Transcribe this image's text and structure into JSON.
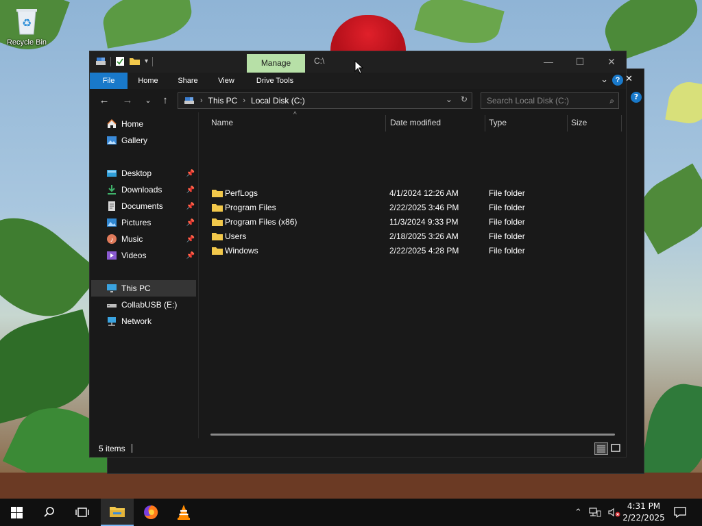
{
  "desktop": {
    "recycle_bin_label": "Recycle Bin"
  },
  "window": {
    "manage_tab": "Manage",
    "title": "C:\\",
    "minimize": "—",
    "maximize": "☐",
    "close": "✕"
  },
  "ribbon": {
    "tabs": [
      "File",
      "Home",
      "Share",
      "View",
      "Drive Tools"
    ]
  },
  "address": {
    "crumbs": [
      "This PC",
      "Local Disk (C:)"
    ],
    "search_placeholder": "Search Local Disk (C:)"
  },
  "nav": {
    "items": [
      "Home",
      "Gallery",
      "Desktop",
      "Downloads",
      "Documents",
      "Pictures",
      "Music",
      "Videos",
      "This PC",
      "CollabUSB (E:)",
      "Network"
    ]
  },
  "columns": [
    "Name",
    "Date modified",
    "Type",
    "Size"
  ],
  "files": [
    {
      "name": "PerfLogs",
      "date": "4/1/2024 12:26 AM",
      "type": "File folder"
    },
    {
      "name": "Program Files",
      "date": "2/22/2025 3:46 PM",
      "type": "File folder"
    },
    {
      "name": "Program Files (x86)",
      "date": "11/3/2024 9:33 PM",
      "type": "File folder"
    },
    {
      "name": "Users",
      "date": "2/18/2025 3:26 AM",
      "type": "File folder"
    },
    {
      "name": "Windows",
      "date": "2/22/2025 4:28 PM",
      "type": "File folder"
    }
  ],
  "status": {
    "item_count": "5 items"
  },
  "taskbar": {
    "time": "4:31 PM",
    "date": "2/22/2025"
  },
  "colors": {
    "accent": "#1979ca",
    "manage_tab": "#b7e0a7",
    "folder": "#f2c84b"
  }
}
